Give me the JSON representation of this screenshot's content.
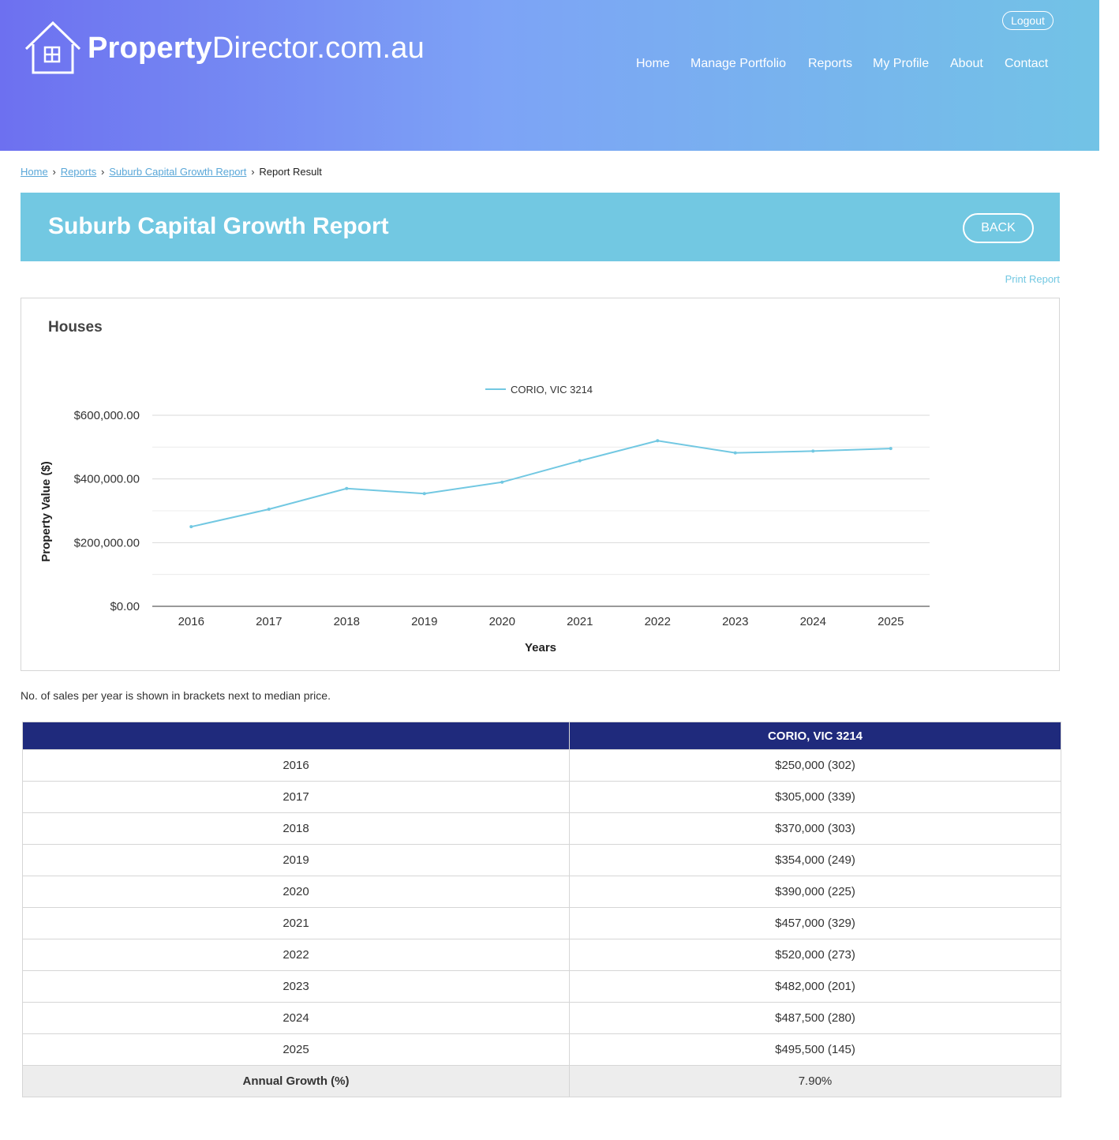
{
  "site": {
    "logo_bold": "Property",
    "logo_light": "Director.com.au",
    "logout_label": "Logout"
  },
  "nav": {
    "items": [
      {
        "label": "Home"
      },
      {
        "label": "Manage Portfolio"
      },
      {
        "label": "Reports"
      },
      {
        "label": "My Profile"
      },
      {
        "label": "About"
      },
      {
        "label": "Contact"
      }
    ]
  },
  "breadcrumb": {
    "links": [
      "Home",
      "Reports",
      "Suburb Capital Growth Report"
    ],
    "current": "Report Result"
  },
  "banner": {
    "title": "Suburb Capital Growth Report",
    "back_label": "BACK"
  },
  "print_label": "Print Report",
  "chart_section": {
    "heading": "Houses"
  },
  "chart_data": {
    "type": "line",
    "x": [
      "2016",
      "2017",
      "2018",
      "2019",
      "2020",
      "2021",
      "2022",
      "2023",
      "2024",
      "2025"
    ],
    "series": [
      {
        "name": "CORIO, VIC 3214",
        "color": "#72c8e2",
        "values": [
          250000,
          305000,
          370000,
          354000,
          390000,
          457000,
          520000,
          482000,
          487500,
          495500
        ]
      }
    ],
    "xlabel": "Years",
    "ylabel": "Property Value ($)",
    "ylim": [
      0,
      600000
    ],
    "y_ticks": [
      "$0.00",
      "$200,000.00",
      "$400,000.00",
      "$600,000.00"
    ],
    "grid": true,
    "legend": "top-center"
  },
  "note": "No. of sales per year is shown in brackets next to median price.",
  "table": {
    "header_year": "",
    "header_suburb": "CORIO, VIC 3214",
    "rows": [
      {
        "year": "2016",
        "value": "$250,000 (302)"
      },
      {
        "year": "2017",
        "value": "$305,000 (339)"
      },
      {
        "year": "2018",
        "value": "$370,000 (303)"
      },
      {
        "year": "2019",
        "value": "$354,000 (249)"
      },
      {
        "year": "2020",
        "value": "$390,000 (225)"
      },
      {
        "year": "2021",
        "value": "$457,000 (329)"
      },
      {
        "year": "2022",
        "value": "$520,000 (273)"
      },
      {
        "year": "2023",
        "value": "$482,000 (201)"
      },
      {
        "year": "2024",
        "value": "$487,500 (280)"
      },
      {
        "year": "2025",
        "value": "$495,500 (145)"
      }
    ],
    "footer_label": "Annual Growth (%)",
    "footer_value": "7.90%"
  }
}
